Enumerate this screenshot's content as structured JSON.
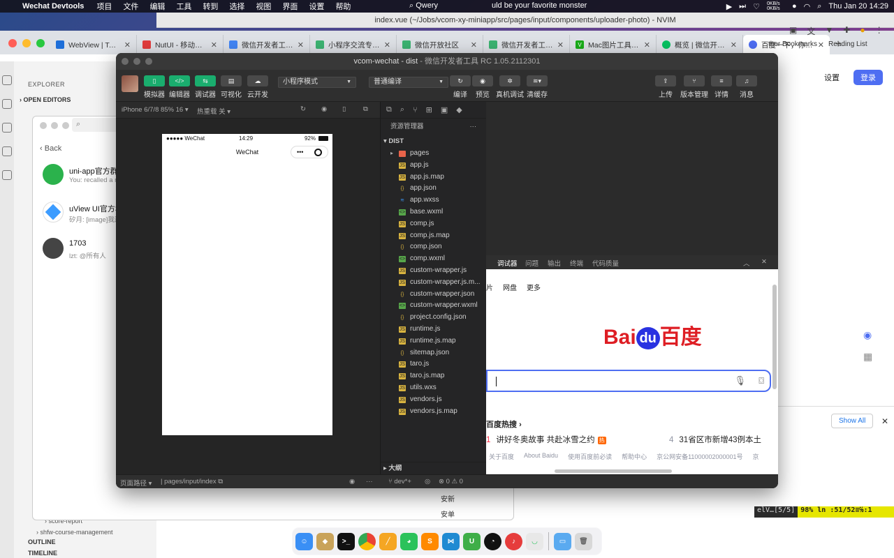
{
  "menubar": {
    "app_name": "Wechat Devtools",
    "items": [
      "项目",
      "文件",
      "编辑",
      "工具",
      "转到",
      "选择",
      "视图",
      "界面",
      "设置",
      "帮助"
    ],
    "qwery": "Qwery",
    "now_playing": "uld be your favorite monster",
    "net_speed": "0KB/s 0KB/s",
    "datetime": "Thu Jan 20  14:29"
  },
  "nvim": {
    "title": "index.vue (~/Jobs/vcom-xy-miniapp/src/pages/input/components/uploader-photo) - NVIM",
    "status_file": "elV…[5/5]",
    "status_pos": "98%  ln :51/52≡℅:1"
  },
  "chrome": {
    "tabs": [
      {
        "title": "WebView | Taro 文",
        "color": "#1e6fd9"
      },
      {
        "title": "NutUI - 移动端 Vu",
        "color": "#e23c3c"
      },
      {
        "title": "微信开发者工具 测",
        "color": "#4285f4"
      },
      {
        "title": "小程序交流专区 | 微",
        "color": "#3cb371"
      },
      {
        "title": "微信开放社区",
        "color": "#3cb371"
      },
      {
        "title": "微信开发者工具调",
        "color": "#3cb371"
      },
      {
        "title": "Mac图片工具'预览",
        "color": "#1aad19"
      },
      {
        "title": "概览 | 微信开放文档",
        "color": "#07c160"
      },
      {
        "title": "百度一下，你就知",
        "color": "#4e6ef2"
      }
    ],
    "new_tab": "+",
    "bookmarks": [
      "ther Bookmarks",
      "Reading List"
    ],
    "baidu_settings": "设置",
    "baidu_login": "登录",
    "show_all": "Show All"
  },
  "vscode": {
    "explorer_header": "EXPLORER",
    "open_editors": "OPEN EDITORS",
    "bottom_items": [
      "score-report",
      "shfw-course-management"
    ],
    "outline": "OUTLINE",
    "timeline": "TIMELINE"
  },
  "wechat": {
    "back": "Back",
    "conversations": [
      {
        "name": "uni-app官方群",
        "msg": "You: recalled a m"
      },
      {
        "name": "uView UI官方3",
        "msg": "矽月: [image]我这"
      },
      {
        "name": "1703",
        "msg": "lzt: @所有人"
      }
    ],
    "bottom_names": [
      "安新",
      "安单"
    ]
  },
  "devtools": {
    "title_main": "vcom-wechat - dist",
    "title_sub": "微信开发者工具 RC 1.05.2112301",
    "toolbar_left": [
      "模拟器",
      "编辑器",
      "调试器",
      "可视化",
      "云开发"
    ],
    "mode_select": "小程序模式",
    "compile_select": "普通编译",
    "toolbar_mid": [
      "编译",
      "预览",
      "真机调试",
      "清缓存"
    ],
    "toolbar_right": [
      "上传",
      "版本管理",
      "详情",
      "消息"
    ],
    "device": "iPhone 6/7/8 85% 16",
    "hot_reload": "热重载 关",
    "phone": {
      "carrier": "●●●●● WeChat",
      "time": "14:29",
      "battery": "92%",
      "nav_title": "WeChat",
      "capsule_dots": "•••"
    },
    "explorer": {
      "header": "资源管理器",
      "more": "···",
      "root": "DIST",
      "files": [
        {
          "name": "pages",
          "type": "folder"
        },
        {
          "name": "app.js",
          "type": "js"
        },
        {
          "name": "app.js.map",
          "type": "js"
        },
        {
          "name": "app.json",
          "type": "json"
        },
        {
          "name": "app.wxss",
          "type": "css"
        },
        {
          "name": "base.wxml",
          "type": "wxml"
        },
        {
          "name": "comp.js",
          "type": "js"
        },
        {
          "name": "comp.js.map",
          "type": "js"
        },
        {
          "name": "comp.json",
          "type": "json"
        },
        {
          "name": "comp.wxml",
          "type": "wxml"
        },
        {
          "name": "custom-wrapper.js",
          "type": "js"
        },
        {
          "name": "custom-wrapper.js.m...",
          "type": "js"
        },
        {
          "name": "custom-wrapper.json",
          "type": "json"
        },
        {
          "name": "custom-wrapper.wxml",
          "type": "wxml"
        },
        {
          "name": "project.config.json",
          "type": "json"
        },
        {
          "name": "runtime.js",
          "type": "js"
        },
        {
          "name": "runtime.js.map",
          "type": "js"
        },
        {
          "name": "sitemap.json",
          "type": "json"
        },
        {
          "name": "taro.js",
          "type": "js"
        },
        {
          "name": "taro.js.map",
          "type": "js"
        },
        {
          "name": "utils.wxs",
          "type": "js"
        },
        {
          "name": "vendors.js",
          "type": "js"
        },
        {
          "name": "vendors.js.map",
          "type": "js"
        }
      ],
      "outline": "大纲"
    },
    "status": {
      "path_label": "页面路径",
      "path": "pages/input/index",
      "branch": "dev*+",
      "errors": "⊗ 0 ⚠ 0"
    },
    "debug_tabs": [
      "调试器",
      "问题",
      "输出",
      "终端",
      "代码质量"
    ],
    "baidu": {
      "links": [
        "图片",
        "网盘",
        "更多"
      ],
      "logo_left": "Bai",
      "logo_du": "du",
      "logo_right": "百度",
      "hot_title": "百度热搜",
      "hot_items": [
        {
          "rank": "1",
          "text": "讲好冬奥故事 共赴冰雪之约",
          "badge": "热"
        },
        {
          "rank": "4",
          "text": "31省区市新增43例本土"
        }
      ],
      "footer": [
        "关于百度",
        "About Baidu",
        "使用百度前必读",
        "帮助中心",
        "京公网安备11000002000001号",
        "京"
      ]
    }
  },
  "colors": {
    "wechat_green": "#1aad6e",
    "baidu_red": "#de1e24",
    "baidu_blue": "#2932e1",
    "search_blue": "#4e6ef2"
  }
}
